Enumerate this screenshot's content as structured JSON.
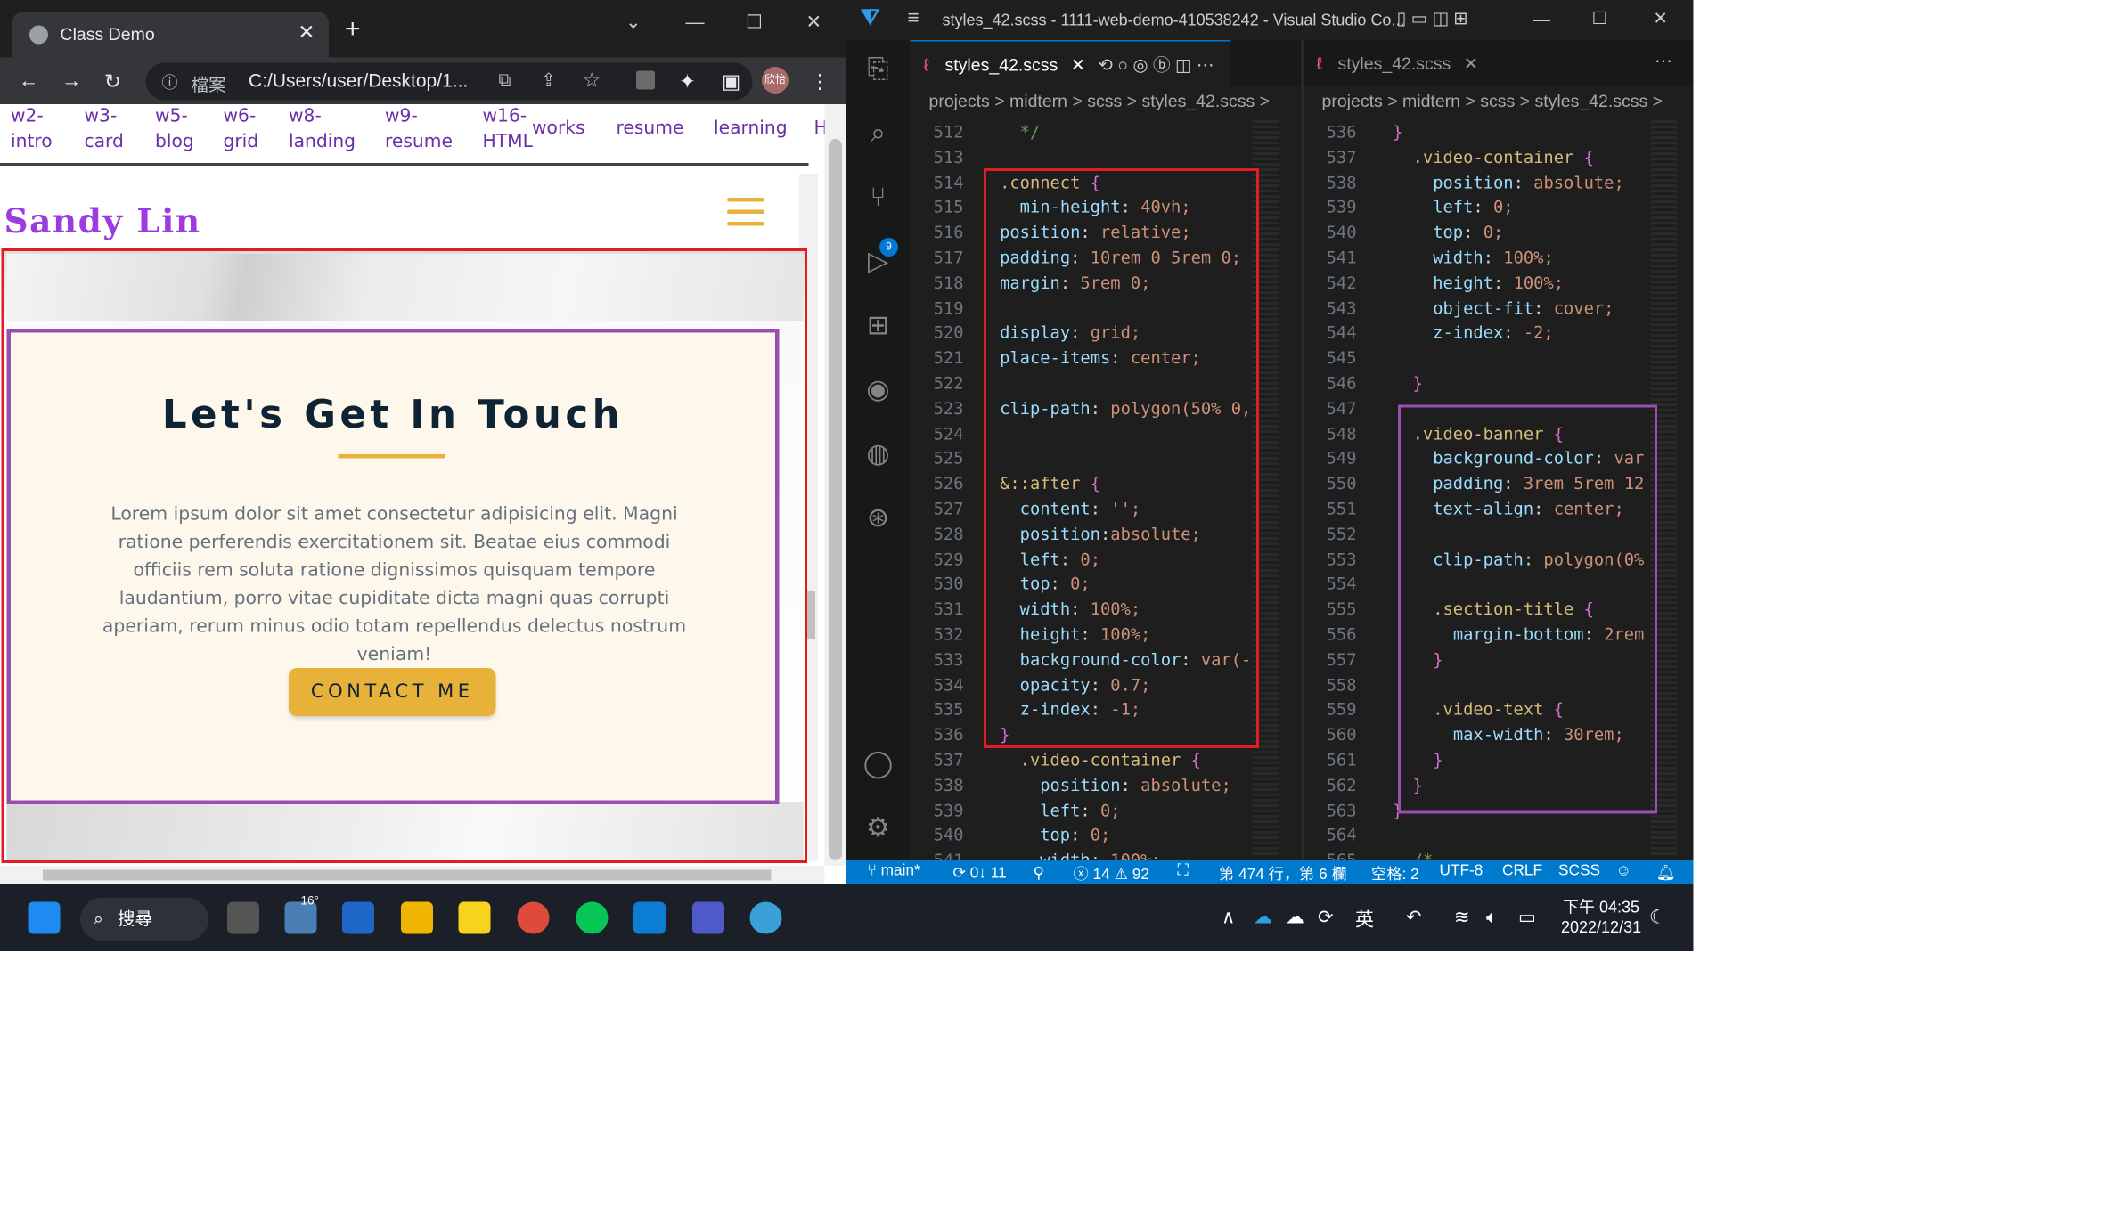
{
  "browser": {
    "tab_title": "Class Demo",
    "omnibox_label": "檔案",
    "url": "C:/Users/user/Desktop/1...",
    "profile": "欣怡"
  },
  "site": {
    "nav": [
      "w2-\nintro",
      "w3-\ncard",
      "w5-\nblog",
      "w6-\ngrid",
      "w8-\nlanding",
      "w9-\nresume",
      "w16-\nHTML",
      "works",
      "resume",
      "learning",
      "H"
    ],
    "brand": "Sandy Lin",
    "connect_title": "Let's Get In Touch",
    "connect_text": "Lorem ipsum dolor sit amet consectetur adipisicing elit. Magni ratione perferendis exercitationem sit. Beatae eius commodi officiis rem soluta ratione dignissimos quisquam tempore laudantium, porro vitae cupiditate dicta magni quas corrupti aperiam, rerum minus odio totam repellendus delectus nostrum veniam!",
    "contact_button": "CONTACT ME"
  },
  "vscode": {
    "window_title": "styles_42.scss - 1111-web-demo-410538242 - Visual Studio Co...",
    "left_tab": "styles_42.scss",
    "right_tab": "styles_42.scss",
    "breadcrumb": "projects  >  midtern  >  scss  >     styles_42.scss  >",
    "left_lines": [
      [
        "512",
        "    */"
      ],
      [
        "513",
        ""
      ],
      [
        "514",
        "  .connect {"
      ],
      [
        "515",
        "    min-height: 40vh;"
      ],
      [
        "516",
        "  position: relative;"
      ],
      [
        "517",
        "  padding: 10rem 0 5rem 0;"
      ],
      [
        "518",
        "  margin: 5rem 0;"
      ],
      [
        "519",
        ""
      ],
      [
        "520",
        "  display: grid;"
      ],
      [
        "521",
        "  place-items: center;"
      ],
      [
        "522",
        ""
      ],
      [
        "523",
        "  clip-path: polygon(50% 0,"
      ],
      [
        "524",
        ""
      ],
      [
        "525",
        ""
      ],
      [
        "526",
        "  &::after {"
      ],
      [
        "527",
        "    content: '';"
      ],
      [
        "528",
        "    position:absolute;"
      ],
      [
        "529",
        "    left: 0;"
      ],
      [
        "530",
        "    top: 0;"
      ],
      [
        "531",
        "    width: 100%;"
      ],
      [
        "532",
        "    height: 100%;"
      ],
      [
        "533",
        "    background-color: var(-"
      ],
      [
        "534",
        "    opacity: 0.7;"
      ],
      [
        "535",
        "    z-index: -1;"
      ],
      [
        "536",
        "  }"
      ],
      [
        "537",
        "    .video-container {"
      ],
      [
        "538",
        "      position: absolute;"
      ],
      [
        "539",
        "      left: 0;"
      ],
      [
        "540",
        "      top: 0;"
      ],
      [
        "541",
        "      width: 100%;"
      ]
    ],
    "right_lines": [
      [
        "536",
        "  }"
      ],
      [
        "537",
        "    .video-container {"
      ],
      [
        "538",
        "      position: absolute;"
      ],
      [
        "539",
        "      left: 0;"
      ],
      [
        "540",
        "      top: 0;"
      ],
      [
        "541",
        "      width: 100%;"
      ],
      [
        "542",
        "      height: 100%;"
      ],
      [
        "543",
        "      object-fit: cover;"
      ],
      [
        "544",
        "      z-index: -2;"
      ],
      [
        "545",
        ""
      ],
      [
        "546",
        "    }"
      ],
      [
        "547",
        ""
      ],
      [
        "548",
        "    .video-banner {"
      ],
      [
        "549",
        "      background-color: var"
      ],
      [
        "550",
        "      padding: 3rem 5rem 12"
      ],
      [
        "551",
        "      text-align: center;"
      ],
      [
        "552",
        ""
      ],
      [
        "553",
        "      clip-path: polygon(0%"
      ],
      [
        "554",
        ""
      ],
      [
        "555",
        "      .section-title {"
      ],
      [
        "556",
        "        margin-bottom: 2rem"
      ],
      [
        "557",
        "      }"
      ],
      [
        "558",
        ""
      ],
      [
        "559",
        "      .video-text {"
      ],
      [
        "560",
        "        max-width: 30rem;"
      ],
      [
        "561",
        "      }"
      ],
      [
        "562",
        "    }"
      ],
      [
        "563",
        "  }"
      ],
      [
        "564",
        ""
      ],
      [
        "565",
        "    /*"
      ]
    ],
    "status": {
      "branch": "main*",
      "sync": "0↓ 11",
      "errors": "ⓧ 14 ⚠ 92",
      "position": "第 474 行，第 6 欄",
      "spaces": "空格: 2",
      "encoding": "UTF-8",
      "eol": "CRLF",
      "language": "SCSS"
    },
    "scm_badge": "9"
  },
  "taskbar": {
    "search": "搜尋",
    "weather": "16°",
    "ime": "英",
    "time": "下午 04:35",
    "date": "2022/12/31"
  },
  "colors": {
    "red_box": "#e31b23",
    "purple_box": "#9a4fb0",
    "accent_yellow": "#e8b23a",
    "vscode_blue": "#007acc"
  }
}
